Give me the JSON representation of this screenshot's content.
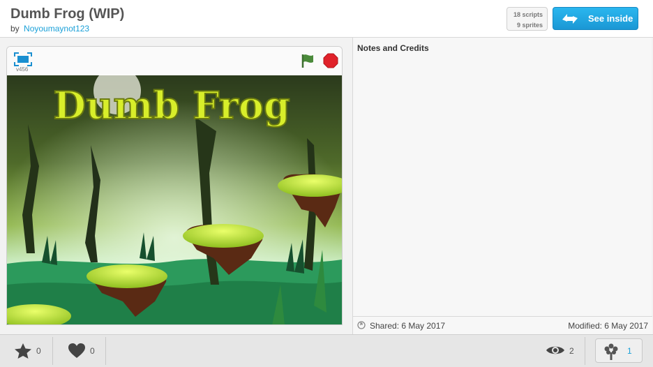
{
  "project": {
    "title": "Dumb Frog (WIP)",
    "by_label": "by",
    "author": "Noyoumaynot123",
    "scripts_count": "18 scripts",
    "sprites_count": "9 sprites",
    "see_inside_label": "See inside"
  },
  "player": {
    "version": "v456",
    "stage_title": "Dumb Frog",
    "icons": [
      "fullscreen-icon",
      "green-flag-icon",
      "stop-icon"
    ],
    "colors": {
      "flag": "#4a8a3a",
      "stop": "#e0222a",
      "title_text": "#d8ee2a"
    }
  },
  "notes": {
    "heading": "Notes and Credits",
    "shared": "Shared: 6 May 2017",
    "modified": "Modified: 6 May 2017"
  },
  "footer": {
    "stars": "0",
    "loves": "0",
    "views": "2",
    "remixes": "1",
    "icons": [
      "star-icon",
      "heart-icon",
      "eye-icon",
      "remix-tree-icon"
    ]
  },
  "colors": {
    "accent": "#1aa0d8",
    "header_bg": "#ffffff",
    "footer_bg": "#e6e6e6"
  }
}
